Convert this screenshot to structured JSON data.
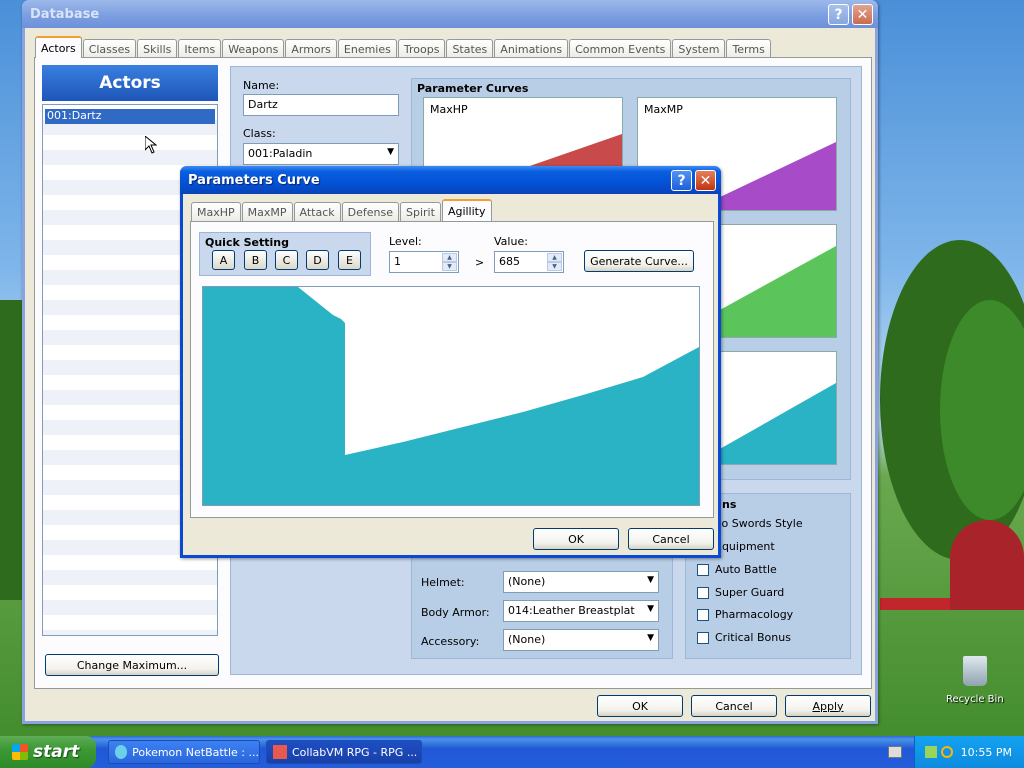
{
  "desktop": {
    "icons": [
      {
        "label": "Recycle Bin"
      }
    ]
  },
  "database_window": {
    "title": "Database",
    "help_btn": "?",
    "close_btn": "✕",
    "tabs": [
      "Actors",
      "Classes",
      "Skills",
      "Items",
      "Weapons",
      "Armors",
      "Enemies",
      "Troops",
      "States",
      "Animations",
      "Common Events",
      "System",
      "Terms"
    ],
    "actors_header": "Actors",
    "actor_list": [
      "001:Dartz"
    ],
    "change_max_btn": "Change Maximum...",
    "name_label": "Name:",
    "name_value": "Dartz",
    "class_label": "Class:",
    "class_value": "001:Paladin",
    "param_curves_title": "Parameter Curves",
    "curves": [
      "MaxHP",
      "MaxMP"
    ],
    "helmet_label": "Helmet:",
    "helmet_value": "(None)",
    "body_armor_label": "Body Armor:",
    "body_armor_value": "014:Leather Breastplat",
    "accessory_label": "Accessory:",
    "accessory_value": "(None)",
    "options_title": "ns",
    "options": [
      {
        "label": "vo Swords Style",
        "checked": false
      },
      {
        "label": "Equipment",
        "checked": false
      },
      {
        "label": "Auto Battle",
        "checked": false
      },
      {
        "label": "Super Guard",
        "checked": false
      },
      {
        "label": "Pharmacology",
        "checked": false
      },
      {
        "label": "Critical Bonus",
        "checked": false
      }
    ],
    "ok": "OK",
    "cancel": "Cancel",
    "apply": "Apply"
  },
  "curve_dialog": {
    "title": "Parameters Curve",
    "help_btn": "?",
    "close_btn": "✕",
    "tabs": [
      "MaxHP",
      "MaxMP",
      "Attack",
      "Defense",
      "Spirit",
      "Agillity"
    ],
    "active_tab": "Agillity",
    "quick_setting_label": "Quick Setting",
    "quick_buttons": [
      "A",
      "B",
      "C",
      "D",
      "E"
    ],
    "level_label": "Level:",
    "level_value": "1",
    "arrow": ">",
    "value_label": "Value:",
    "value_value": "685",
    "generate_btn": "Generate Curve...",
    "ok": "OK",
    "cancel": "Cancel",
    "curve_color": "#2ab3c4"
  },
  "taskbar": {
    "start": "start",
    "items": [
      "Pokemon NetBattle : ...",
      "CollabVM RPG - RPG ..."
    ],
    "clock": "10:55 PM"
  },
  "colors": {
    "hp": "#c94a4a",
    "mp": "#a84bc8",
    "green": "#5bc55b",
    "cyan": "#2ab3c4",
    "xp_blue": "#0a48d6"
  }
}
